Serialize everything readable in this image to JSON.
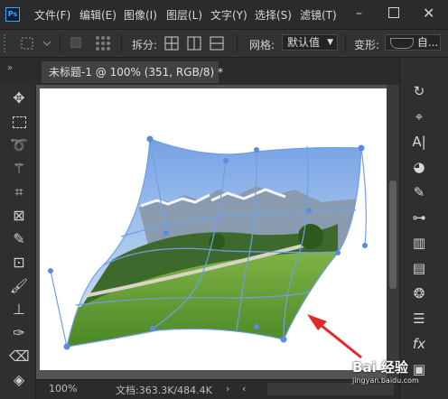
{
  "menubar": {
    "logo": "Ps",
    "items": [
      "文件(F)",
      "编辑(E)",
      "图像(I)",
      "图层(L)",
      "文字(Y)",
      "选择(S)",
      "滤镜(T)"
    ]
  },
  "options": {
    "split_label": "拆分:",
    "grid_label": "网格:",
    "grid_value": "默认值",
    "warp_label": "变形:",
    "warp_value": "自..."
  },
  "document": {
    "tab_title": "未标题-1 @ 100% (351, RGB/8) *"
  },
  "status": {
    "zoom": "100%",
    "doc_info": "文档:363.3K/484.4K"
  },
  "watermark": "Bai 经验",
  "watermark_sub": "jingyan.baidu.com",
  "colors": {
    "accent": "#31a8ff",
    "grid_line": "#6f9fe6",
    "arrow": "#e02a2a"
  },
  "tools": [
    "move-icon",
    "marquee-icon",
    "lasso-icon",
    "magic-wand-icon",
    "crop-icon",
    "frame-icon",
    "eyedropper-icon",
    "patch-icon",
    "brush-icon",
    "stamp-icon",
    "history-brush-icon",
    "eraser-icon",
    "bucket-icon"
  ],
  "panels": [
    "history-icon",
    "paths-icon",
    "character-icon",
    "color-icon",
    "brushes-icon",
    "adjustments-icon",
    "gradient-icon",
    "libraries-icon",
    "channels-icon",
    "properties-icon",
    "fx-icon",
    "layers-icon"
  ]
}
